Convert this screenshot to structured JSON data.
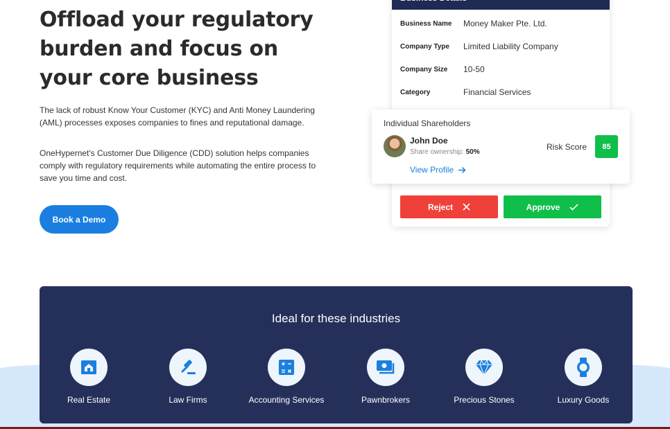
{
  "hero": {
    "title": "Offload your regulatory burden and focus on your core business",
    "paragraph1": "The lack of robust Know Your Customer (KYC) and Anti Money Laundering (AML) processes exposes companies to fines and reputational damage.",
    "paragraph2": "OneHypernet's Customer Due Diligence (CDD) solution helps companies comply with regulatory requirements while automating the entire process to save you time and cost.",
    "cta_label": "Book a Demo"
  },
  "business_card": {
    "header": "Business Details",
    "rows": [
      {
        "key": "Business Name",
        "value": "Money Maker Pte. Ltd."
      },
      {
        "key": "Company Type",
        "value": "Limited Liability Company"
      },
      {
        "key": "Company Size",
        "value": "10-50"
      },
      {
        "key": "Category",
        "value": "Financial Services"
      }
    ],
    "reject_label": "Reject",
    "approve_label": "Approve"
  },
  "shareholder_card": {
    "title": "Individual Shareholders",
    "name": "John Doe",
    "ownership_label": "Share ownership:",
    "ownership_value": "50%",
    "view_profile_label": "View Profile",
    "risk_label": "Risk Score",
    "risk_value": "85"
  },
  "industries": {
    "title": "Ideal for these industries",
    "items": [
      {
        "label": "Real Estate",
        "icon": "house-icon"
      },
      {
        "label": "Law Firms",
        "icon": "gavel-icon"
      },
      {
        "label": "Accounting Services",
        "icon": "calculator-icon"
      },
      {
        "label": "Pawnbrokers",
        "icon": "money-icon"
      },
      {
        "label": "Precious Stones",
        "icon": "diamond-icon"
      },
      {
        "label": "Luxury Goods",
        "icon": "watch-icon"
      }
    ]
  },
  "colors": {
    "accent_blue": "#1a7fe0",
    "navy": "#25305a",
    "reject_red": "#f0403a",
    "approve_green": "#0fbf4a",
    "icon_blue": "#1a7fe0"
  }
}
